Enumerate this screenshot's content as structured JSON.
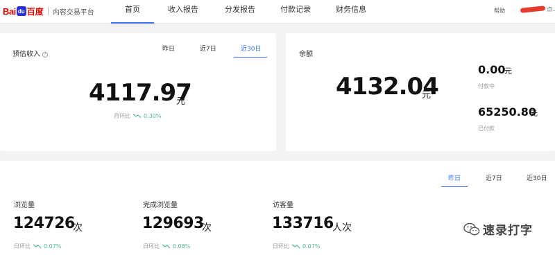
{
  "header": {
    "logo_bai": "Bai",
    "logo_paw": "du",
    "logo_cn": "百度",
    "logo_sub": "内容交易平台",
    "nav": [
      "首页",
      "收入报告",
      "分发报告",
      "付款记录",
      "财务信息"
    ],
    "help": "帮助",
    "user_suffix": "点..."
  },
  "income": {
    "title": "预估收入",
    "help_icon": "question-icon",
    "tabs": [
      "昨日",
      "近7日",
      "近30日"
    ],
    "active_tab": "近30日",
    "value": "4117.97",
    "unit": "元",
    "compare_label": "月环比",
    "compare_pct": "0.30%"
  },
  "balance": {
    "title": "余额",
    "value": "4132.04",
    "unit": "元",
    "paying_value": "0.00",
    "paying_unit": "元",
    "paying_label": "付款中",
    "paid_value": "65250.80",
    "paid_unit": "元",
    "paid_label": "已付款"
  },
  "traffic": {
    "tabs": [
      "昨日",
      "近7日",
      "近30日"
    ],
    "active_tab": "昨日",
    "metrics": [
      {
        "label": "浏览量",
        "value": "124726",
        "unit": "次",
        "compare_label": "日环比",
        "compare_pct": "0.07%"
      },
      {
        "label": "完成浏览量",
        "value": "129693",
        "unit": "次",
        "compare_label": "日环比",
        "compare_pct": "0.08%"
      },
      {
        "label": "访客量",
        "value": "133716",
        "unit": "人次",
        "compare_label": "日环比",
        "compare_pct": "0.07%"
      }
    ]
  },
  "watermark": {
    "icon": "wechat-icon",
    "text": "速录打字"
  },
  "colors": {
    "accent": "#3a6ff4",
    "trend_green": "#4bb58a",
    "brand_red": "#e10602"
  }
}
